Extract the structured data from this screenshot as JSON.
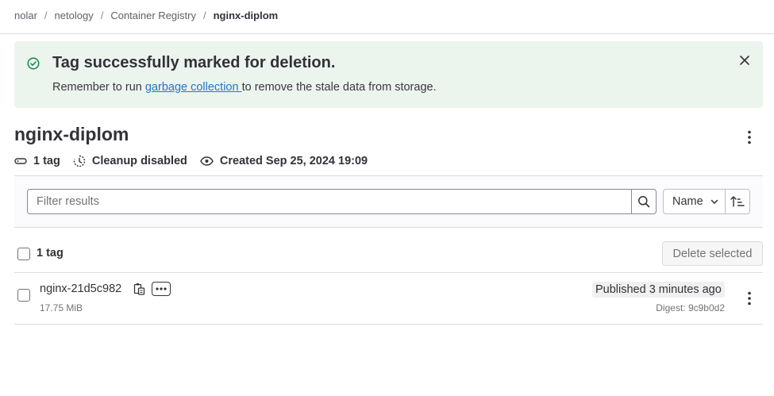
{
  "breadcrumb": {
    "items": [
      "nolar",
      "netology",
      "Container Registry"
    ],
    "current": "nginx-diplom",
    "separator": "/"
  },
  "alert": {
    "title": "Tag successfully marked for deletion.",
    "body_before": "Remember to run ",
    "link_text": "garbage collection ",
    "body_after": "to remove the stale data from storage.",
    "background": "#ecf4ee",
    "icon_color": "#108548"
  },
  "header": {
    "title": "nginx-diplom",
    "meta": {
      "tag_count": "1 tag",
      "cleanup": "Cleanup disabled",
      "created": "Created Sep 25, 2024 19:09"
    }
  },
  "filter": {
    "placeholder": "Filter results",
    "sort_label": "Name"
  },
  "list": {
    "header_count": "1 tag",
    "delete_selected_label": "Delete selected",
    "rows": [
      {
        "name": "nginx-21d5c982",
        "size": "17.75 MiB",
        "published": "Published 3 minutes ago",
        "digest": "Digest: 9c9b0d2"
      }
    ]
  },
  "icons": {
    "alert": "check-circle-icon",
    "close": "close-icon",
    "kebab": "ellipsis-v-icon",
    "tag": "label-icon",
    "cleanup": "expire-icon",
    "created": "eye-icon",
    "search": "search-icon",
    "chevron": "chevron-down-icon",
    "sort": "sort-lowest-icon",
    "copy": "copy-to-clipboard-icon",
    "more": "ellipsis-h-icon"
  }
}
